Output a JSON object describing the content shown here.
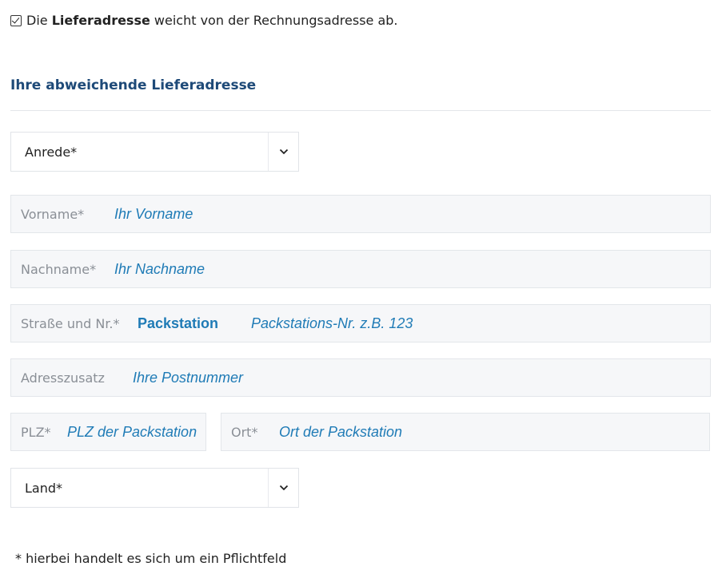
{
  "checkbox": {
    "checked": true,
    "text_before": "Die ",
    "text_bold": "Lieferadresse",
    "text_after": " weicht von der Rechnungsadresse ab."
  },
  "section": {
    "title": "Ihre abweichende Lieferadresse"
  },
  "form": {
    "salutation": {
      "label": "Anrede*"
    },
    "firstname": {
      "label": "Vorname*",
      "value": "Ihr Vorname"
    },
    "lastname": {
      "label": "Nachname*",
      "value": "Ihr Nachname"
    },
    "street": {
      "label": "Straße und Nr.*",
      "value_bold": "Packstation",
      "value": "Packstations-Nr. z.B. 123"
    },
    "addition": {
      "label": "Adresszusatz",
      "value": "Ihre Postnummer"
    },
    "zip": {
      "label": "PLZ*",
      "value": "PLZ der Packstation"
    },
    "city": {
      "label": "Ort*",
      "value": "Ort der Packstation"
    },
    "country": {
      "label": "Land*"
    }
  },
  "footnote": "* hierbei handelt es sich um ein Pflichtfeld",
  "colors": {
    "title": "#1e4a78",
    "field_value": "#1f7bb6",
    "field_bg": "#f6f7f9"
  },
  "icons": {
    "select_chevron": "chevron-down-icon",
    "checkbox": "checkmark-icon"
  }
}
